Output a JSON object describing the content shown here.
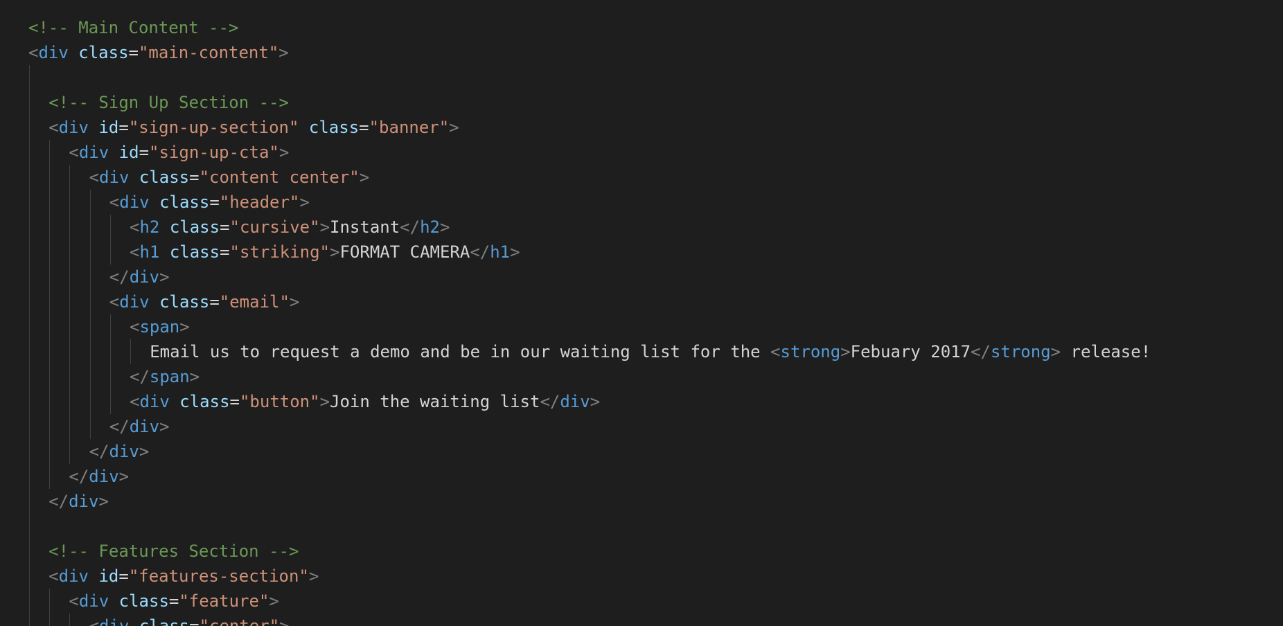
{
  "colors": {
    "background": "#1e1e1e",
    "comment": "#6a9955",
    "punctuation": "#808080",
    "tag": "#569cd6",
    "attribute": "#9cdcfe",
    "string": "#ce9178",
    "text": "#d4d4d4",
    "indent_guide": "#404040"
  },
  "lines": [
    {
      "indent": 0,
      "tokens": [
        {
          "t": "comment",
          "v": "<!-- Main Content -->"
        }
      ]
    },
    {
      "indent": 0,
      "tokens": [
        {
          "t": "punct",
          "v": "<"
        },
        {
          "t": "tag",
          "v": "div"
        },
        {
          "t": "text",
          "v": " "
        },
        {
          "t": "attr",
          "v": "class"
        },
        {
          "t": "eq",
          "v": "="
        },
        {
          "t": "str",
          "v": "\"main-content\""
        },
        {
          "t": "punct",
          "v": ">"
        }
      ]
    },
    {
      "indent": 0,
      "tokens": []
    },
    {
      "indent": 1,
      "tokens": [
        {
          "t": "comment",
          "v": "<!-- Sign Up Section -->"
        }
      ]
    },
    {
      "indent": 1,
      "tokens": [
        {
          "t": "punct",
          "v": "<"
        },
        {
          "t": "tag",
          "v": "div"
        },
        {
          "t": "text",
          "v": " "
        },
        {
          "t": "attr",
          "v": "id"
        },
        {
          "t": "eq",
          "v": "="
        },
        {
          "t": "str",
          "v": "\"sign-up-section\""
        },
        {
          "t": "text",
          "v": " "
        },
        {
          "t": "attr",
          "v": "class"
        },
        {
          "t": "eq",
          "v": "="
        },
        {
          "t": "str",
          "v": "\"banner\""
        },
        {
          "t": "punct",
          "v": ">"
        }
      ]
    },
    {
      "indent": 2,
      "tokens": [
        {
          "t": "punct",
          "v": "<"
        },
        {
          "t": "tag",
          "v": "div"
        },
        {
          "t": "text",
          "v": " "
        },
        {
          "t": "attr",
          "v": "id"
        },
        {
          "t": "eq",
          "v": "="
        },
        {
          "t": "str",
          "v": "\"sign-up-cta\""
        },
        {
          "t": "punct",
          "v": ">"
        }
      ]
    },
    {
      "indent": 3,
      "tokens": [
        {
          "t": "punct",
          "v": "<"
        },
        {
          "t": "tag",
          "v": "div"
        },
        {
          "t": "text",
          "v": " "
        },
        {
          "t": "attr",
          "v": "class"
        },
        {
          "t": "eq",
          "v": "="
        },
        {
          "t": "str",
          "v": "\"content center\""
        },
        {
          "t": "punct",
          "v": ">"
        }
      ]
    },
    {
      "indent": 4,
      "tokens": [
        {
          "t": "punct",
          "v": "<"
        },
        {
          "t": "tag",
          "v": "div"
        },
        {
          "t": "text",
          "v": " "
        },
        {
          "t": "attr",
          "v": "class"
        },
        {
          "t": "eq",
          "v": "="
        },
        {
          "t": "str",
          "v": "\"header\""
        },
        {
          "t": "punct",
          "v": ">"
        }
      ]
    },
    {
      "indent": 5,
      "tokens": [
        {
          "t": "punct",
          "v": "<"
        },
        {
          "t": "tag",
          "v": "h2"
        },
        {
          "t": "text",
          "v": " "
        },
        {
          "t": "attr",
          "v": "class"
        },
        {
          "t": "eq",
          "v": "="
        },
        {
          "t": "str",
          "v": "\"cursive\""
        },
        {
          "t": "punct",
          "v": ">"
        },
        {
          "t": "text",
          "v": "Instant"
        },
        {
          "t": "punct",
          "v": "</"
        },
        {
          "t": "tag",
          "v": "h2"
        },
        {
          "t": "punct",
          "v": ">"
        }
      ]
    },
    {
      "indent": 5,
      "tokens": [
        {
          "t": "punct",
          "v": "<"
        },
        {
          "t": "tag",
          "v": "h1"
        },
        {
          "t": "text",
          "v": " "
        },
        {
          "t": "attr",
          "v": "class"
        },
        {
          "t": "eq",
          "v": "="
        },
        {
          "t": "str",
          "v": "\"striking\""
        },
        {
          "t": "punct",
          "v": ">"
        },
        {
          "t": "text",
          "v": "FORMAT CAMERA"
        },
        {
          "t": "punct",
          "v": "</"
        },
        {
          "t": "tag",
          "v": "h1"
        },
        {
          "t": "punct",
          "v": ">"
        }
      ]
    },
    {
      "indent": 4,
      "tokens": [
        {
          "t": "punct",
          "v": "</"
        },
        {
          "t": "tag",
          "v": "div"
        },
        {
          "t": "punct",
          "v": ">"
        }
      ]
    },
    {
      "indent": 4,
      "tokens": [
        {
          "t": "punct",
          "v": "<"
        },
        {
          "t": "tag",
          "v": "div"
        },
        {
          "t": "text",
          "v": " "
        },
        {
          "t": "attr",
          "v": "class"
        },
        {
          "t": "eq",
          "v": "="
        },
        {
          "t": "str",
          "v": "\"email\""
        },
        {
          "t": "punct",
          "v": ">"
        }
      ]
    },
    {
      "indent": 5,
      "tokens": [
        {
          "t": "punct",
          "v": "<"
        },
        {
          "t": "tag",
          "v": "span"
        },
        {
          "t": "punct",
          "v": ">"
        }
      ]
    },
    {
      "indent": 6,
      "tokens": [
        {
          "t": "text",
          "v": "Email us to request a demo and be in our waiting list for the "
        },
        {
          "t": "punct",
          "v": "<"
        },
        {
          "t": "tag",
          "v": "strong"
        },
        {
          "t": "punct",
          "v": ">"
        },
        {
          "t": "text",
          "v": "Febuary 2017"
        },
        {
          "t": "punct",
          "v": "</"
        },
        {
          "t": "tag",
          "v": "strong"
        },
        {
          "t": "punct",
          "v": ">"
        },
        {
          "t": "text",
          "v": " release!"
        }
      ]
    },
    {
      "indent": 5,
      "tokens": [
        {
          "t": "punct",
          "v": "</"
        },
        {
          "t": "tag",
          "v": "span"
        },
        {
          "t": "punct",
          "v": ">"
        }
      ]
    },
    {
      "indent": 5,
      "tokens": [
        {
          "t": "punct",
          "v": "<"
        },
        {
          "t": "tag",
          "v": "div"
        },
        {
          "t": "text",
          "v": " "
        },
        {
          "t": "attr",
          "v": "class"
        },
        {
          "t": "eq",
          "v": "="
        },
        {
          "t": "str",
          "v": "\"button\""
        },
        {
          "t": "punct",
          "v": ">"
        },
        {
          "t": "text",
          "v": "Join the waiting list"
        },
        {
          "t": "punct",
          "v": "</"
        },
        {
          "t": "tag",
          "v": "div"
        },
        {
          "t": "punct",
          "v": ">"
        }
      ]
    },
    {
      "indent": 4,
      "tokens": [
        {
          "t": "punct",
          "v": "</"
        },
        {
          "t": "tag",
          "v": "div"
        },
        {
          "t": "punct",
          "v": ">"
        }
      ]
    },
    {
      "indent": 3,
      "tokens": [
        {
          "t": "punct",
          "v": "</"
        },
        {
          "t": "tag",
          "v": "div"
        },
        {
          "t": "punct",
          "v": ">"
        }
      ]
    },
    {
      "indent": 2,
      "tokens": [
        {
          "t": "punct",
          "v": "</"
        },
        {
          "t": "tag",
          "v": "div"
        },
        {
          "t": "punct",
          "v": ">"
        }
      ]
    },
    {
      "indent": 1,
      "tokens": [
        {
          "t": "punct",
          "v": "</"
        },
        {
          "t": "tag",
          "v": "div"
        },
        {
          "t": "punct",
          "v": ">"
        }
      ]
    },
    {
      "indent": 0,
      "tokens": []
    },
    {
      "indent": 1,
      "tokens": [
        {
          "t": "comment",
          "v": "<!-- Features Section -->"
        }
      ]
    },
    {
      "indent": 1,
      "tokens": [
        {
          "t": "punct",
          "v": "<"
        },
        {
          "t": "tag",
          "v": "div"
        },
        {
          "t": "text",
          "v": " "
        },
        {
          "t": "attr",
          "v": "id"
        },
        {
          "t": "eq",
          "v": "="
        },
        {
          "t": "str",
          "v": "\"features-section\""
        },
        {
          "t": "punct",
          "v": ">"
        }
      ]
    },
    {
      "indent": 2,
      "tokens": [
        {
          "t": "punct",
          "v": "<"
        },
        {
          "t": "tag",
          "v": "div"
        },
        {
          "t": "text",
          "v": " "
        },
        {
          "t": "attr",
          "v": "class"
        },
        {
          "t": "eq",
          "v": "="
        },
        {
          "t": "str",
          "v": "\"feature\""
        },
        {
          "t": "punct",
          "v": ">"
        }
      ]
    },
    {
      "indent": 3,
      "tokens": [
        {
          "t": "punct",
          "v": "<"
        },
        {
          "t": "tag",
          "v": "div"
        },
        {
          "t": "text",
          "v": " "
        },
        {
          "t": "attr",
          "v": "class"
        },
        {
          "t": "eq",
          "v": "="
        },
        {
          "t": "str",
          "v": "\"center\""
        },
        {
          "t": "punct",
          "v": ">"
        }
      ]
    }
  ]
}
